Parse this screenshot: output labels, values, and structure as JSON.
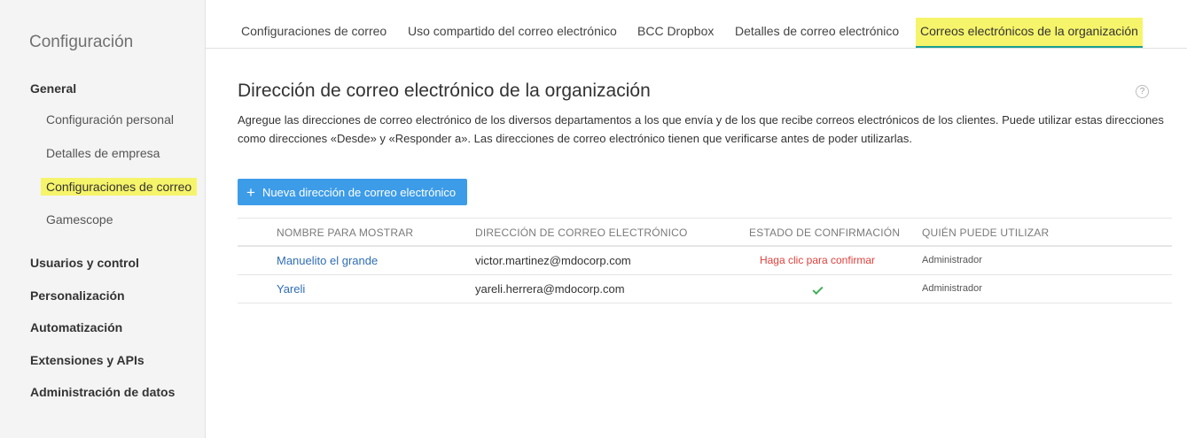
{
  "sidebar": {
    "title": "Configuración",
    "general_label": "General",
    "sub_items": {
      "personal": "Configuración personal",
      "company": "Detalles de empresa",
      "mail": "Configuraciones de correo",
      "gamescope": "Gamescope"
    },
    "sections": {
      "users": "Usuarios y control",
      "custom": "Personalización",
      "automation": "Automatización",
      "extensions": "Extensiones y APIs",
      "data": "Administración de datos"
    }
  },
  "tabs": {
    "mail_settings": "Configuraciones de correo",
    "mail_sharing": "Uso compartido del correo electrónico",
    "bcc_dropbox": "BCC Dropbox",
    "mail_details": "Detalles de correo electrónico",
    "org_emails": "Correos electrónicos de la organización"
  },
  "main": {
    "title": "Dirección de correo electrónico de la organización",
    "help_symbol": "?",
    "description": "Agregue las direcciones de correo electrónico de los diversos departamentos a los que envía y de los que recibe correos electrónicos de los clientes. Puede utilizar estas direcciones como direcciones «Desde» y «Responder a». Las direcciones de correo electrónico tienen que verificarse antes de poder utilizarlas.",
    "add_button_label": "Nueva dirección de correo electrónico"
  },
  "table": {
    "headers": {
      "display_name": "NOMBRE PARA MOSTRAR",
      "email": "DIRECCIÓN DE CORREO ELECTRÓNICO",
      "status": "ESTADO DE CONFIRMACIÓN",
      "who": "QUIÉN PUEDE UTILIZAR"
    },
    "rows": [
      {
        "name": "Manuelito el grande",
        "email": "victor.martinez@mdocorp.com",
        "status": "Haga clic para confirmar",
        "who": "Administrador"
      },
      {
        "name": "Yareli",
        "email": "yareli.herrera@mdocorp.com",
        "status_icon": "check-icon",
        "who": "Administrador"
      }
    ]
  },
  "colors": {
    "highlight": "#f6f46a",
    "accent_blue": "#3d9ce8",
    "link_blue": "#2f6db5",
    "alert_red": "#e0413c",
    "success_green": "#3fae57"
  }
}
